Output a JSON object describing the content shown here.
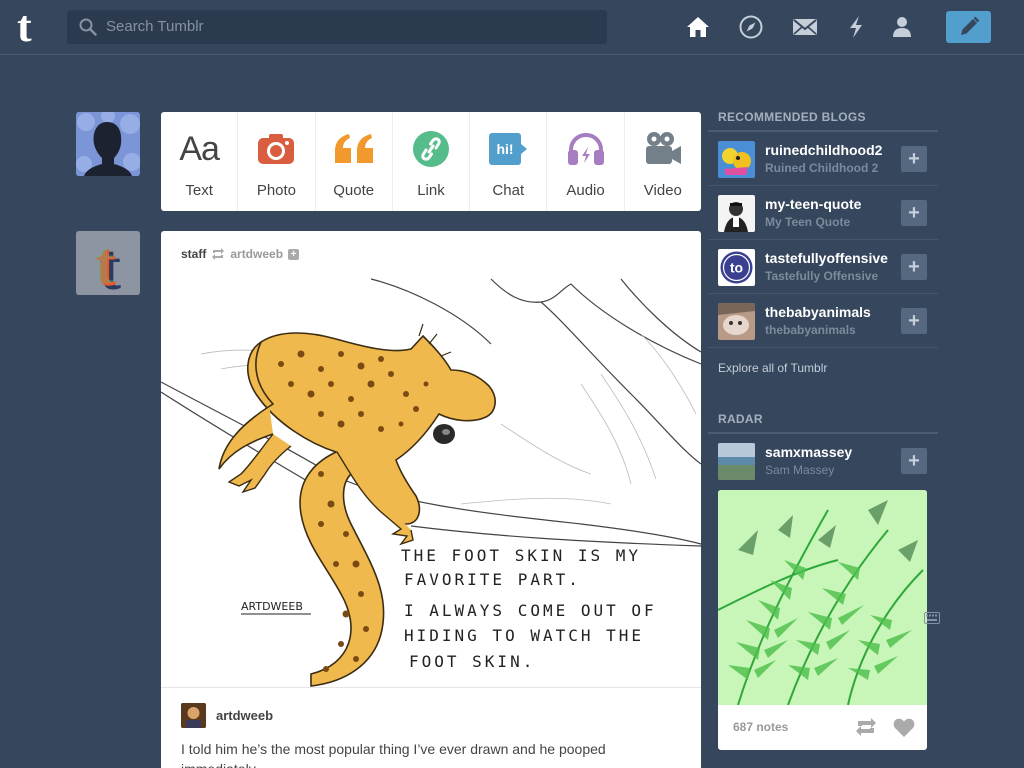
{
  "header": {
    "search_placeholder": "Search Tumblr",
    "logo_letter": "t"
  },
  "post_types": [
    {
      "label": "Text",
      "icon": "text-icon",
      "glyph": "Aa",
      "color": "#444444"
    },
    {
      "label": "Photo",
      "icon": "camera-icon",
      "color": "#d95e40"
    },
    {
      "label": "Quote",
      "icon": "quote-icon",
      "glyph": "66",
      "color": "#f2992e"
    },
    {
      "label": "Link",
      "icon": "link-icon",
      "color": "#56bc8a"
    },
    {
      "label": "Chat",
      "icon": "chat-icon",
      "glyph": "hi!",
      "color": "#529ecc"
    },
    {
      "label": "Audio",
      "icon": "headphones-icon",
      "color": "#a77dc2"
    },
    {
      "label": "Video",
      "icon": "video-camera-icon",
      "color": "#748089"
    }
  ],
  "post": {
    "author": "staff",
    "reblogged_from": "artdweeb",
    "image_text": {
      "line1": "THE FOOT SKIN IS MY",
      "line2": "FAVORITE PART.",
      "line3": "I ALWAYS COME OUT OF",
      "line4": "HIDING TO WATCH THE",
      "line5": "FOOT SKIN.",
      "signature": "ARTDWEEB"
    },
    "caption_author": "artdweeb",
    "caption_text": "I told him he’s the most popular thing I’ve ever drawn and he pooped immediately."
  },
  "sidebar": {
    "recommended_title": "RECOMMENDED BLOGS",
    "blogs": [
      {
        "name": "ruinedchildhood2",
        "subtitle": "Ruined Childhood 2"
      },
      {
        "name": "my-teen-quote",
        "subtitle": "My Teen Quote"
      },
      {
        "name": "tastefullyoffensive",
        "subtitle": "Tastefully Offensive"
      },
      {
        "name": "thebabyanimals",
        "subtitle": "thebabyanimals"
      }
    ],
    "explore_label": "Explore all of Tumblr",
    "radar_title": "RADAR",
    "radar": {
      "name": "samxmassey",
      "subtitle": "Sam Massey",
      "notes": "687 notes"
    }
  },
  "colors": {
    "background": "#36465d",
    "accent": "#529ecc"
  }
}
